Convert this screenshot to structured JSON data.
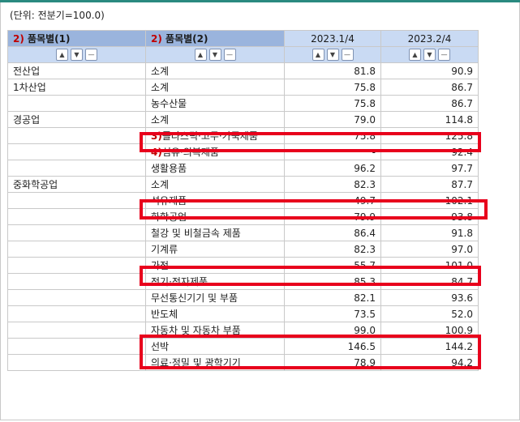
{
  "unit_label": "(단위: 전분기=100.0)",
  "header": {
    "col1_num": "2)",
    "col1_label": "품목별(1)",
    "col2_num": "2)",
    "col2_label": "품목별(2)",
    "col3_label": "2023.1/4",
    "col4_label": "2023.2/4"
  },
  "sort_icons": [
    "sort-up-icon",
    "sort-down-icon",
    "sort-reset-icon"
  ],
  "rows": [
    {
      "cat1": "전산업",
      "cat2": "소계",
      "note": "",
      "v1": "81.8",
      "v2": "90.9"
    },
    {
      "cat1": "1차산업",
      "cat2": "소계",
      "note": "",
      "v1": "75.8",
      "v2": "86.7"
    },
    {
      "cat1": "",
      "cat2": "농수산물",
      "note": "",
      "v1": "75.8",
      "v2": "86.7"
    },
    {
      "cat1": "경공업",
      "cat2": "소계",
      "note": "",
      "v1": "79.0",
      "v2": "114.8"
    },
    {
      "cat1": "",
      "cat2": "플라스틱·고무·가죽제품",
      "note": "3)",
      "v1": "75.8",
      "v2": "125.8"
    },
    {
      "cat1": "",
      "cat2": "섬유·의복제품",
      "note": "4)",
      "v1": "-",
      "v2": "92.4"
    },
    {
      "cat1": "",
      "cat2": "생활용품",
      "note": "",
      "v1": "96.2",
      "v2": "97.7"
    },
    {
      "cat1": "중화학공업",
      "cat2": "소계",
      "note": "",
      "v1": "82.3",
      "v2": "87.7"
    },
    {
      "cat1": "",
      "cat2": "석유제품",
      "note": "",
      "v1": "49.7",
      "v2": "102.1"
    },
    {
      "cat1": "",
      "cat2": "화학공업",
      "note": "",
      "v1": "79.9",
      "v2": "93.8"
    },
    {
      "cat1": "",
      "cat2": "철강 및 비철금속 제품",
      "note": "",
      "v1": "86.4",
      "v2": "91.8"
    },
    {
      "cat1": "",
      "cat2": "기계류",
      "note": "",
      "v1": "82.3",
      "v2": "97.0"
    },
    {
      "cat1": "",
      "cat2": "가전",
      "note": "",
      "v1": "55.7",
      "v2": "101.0"
    },
    {
      "cat1": "",
      "cat2": "전기·전자제품",
      "note": "",
      "v1": "85.3",
      "v2": "84.7"
    },
    {
      "cat1": "",
      "cat2": "무선통신기기 및 부품",
      "note": "",
      "v1": "82.1",
      "v2": "93.6"
    },
    {
      "cat1": "",
      "cat2": "반도체",
      "note": "",
      "v1": "73.5",
      "v2": "52.0"
    },
    {
      "cat1": "",
      "cat2": "자동차 및 자동차 부품",
      "note": "",
      "v1": "99.0",
      "v2": "100.9"
    },
    {
      "cat1": "",
      "cat2": "선박",
      "note": "",
      "v1": "146.5",
      "v2": "144.2"
    },
    {
      "cat1": "",
      "cat2": "의료·정밀 및 광학기기",
      "note": "",
      "v1": "78.9",
      "v2": "94.2"
    }
  ],
  "highlight_color": "#e8001c"
}
